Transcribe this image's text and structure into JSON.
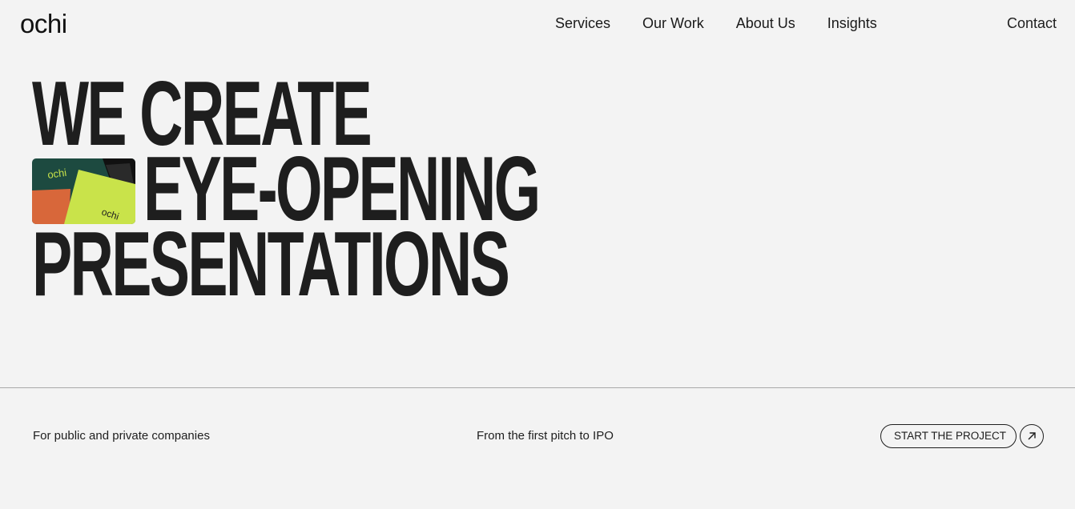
{
  "brand": {
    "logo_text": "ochi"
  },
  "nav": {
    "links": [
      {
        "label": "Services"
      },
      {
        "label": "Our Work"
      },
      {
        "label": "About Us"
      },
      {
        "label": "Insights"
      }
    ],
    "contact_label": "Contact"
  },
  "hero": {
    "line1": "WE CREATE",
    "line2": "EYE-OPENING",
    "line3": "PRESENTATIONS",
    "image": {
      "card_logo_text": "ochi",
      "colors": {
        "dark_green": "#1d4a40",
        "lime": "#c9e34a",
        "orange": "#d8673a",
        "black": "#111111"
      }
    }
  },
  "footer": {
    "tagline_left": "For public and private companies",
    "tagline_middle": "From the first pitch to IPO",
    "cta_label": "START THE PROJECT"
  },
  "colors": {
    "background": "#f3f3f3",
    "text": "#1e1e1e",
    "divider": "#a9a9a9"
  }
}
